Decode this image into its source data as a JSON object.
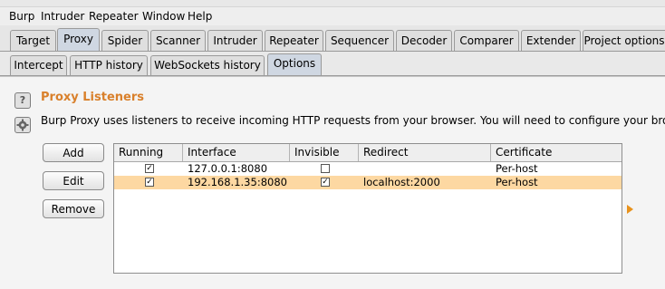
{
  "menubar": [
    "Burp",
    "Intruder",
    "Repeater",
    "Window",
    "Help"
  ],
  "main_tabs": [
    "Target",
    "Proxy",
    "Spider",
    "Scanner",
    "Intruder",
    "Repeater",
    "Sequencer",
    "Decoder",
    "Comparer",
    "Extender",
    "Project options"
  ],
  "selected_main_tab": "Proxy",
  "sub_tabs": [
    "Intercept",
    "HTTP history",
    "WebSockets history",
    "Options"
  ],
  "selected_sub_tab": "Options",
  "section": {
    "help_icon_glyph": "?",
    "title": "Proxy Listeners",
    "description": "Burp Proxy uses listeners to receive incoming HTTP requests from your browser. You will need to configure your browse"
  },
  "buttons": {
    "add": "Add",
    "edit": "Edit",
    "remove": "Remove"
  },
  "table": {
    "columns": [
      "Running",
      "Interface",
      "Invisible",
      "Redirect",
      "Certificate"
    ],
    "rows": [
      {
        "running": true,
        "interface": "127.0.0.1:8080",
        "invisible": false,
        "redirect": "",
        "certificate": "Per-host",
        "selected": false
      },
      {
        "running": true,
        "interface": "192.168.1.35:8080",
        "invisible": true,
        "redirect": "localhost:2000",
        "certificate": "Per-host",
        "selected": true
      }
    ]
  },
  "colors": {
    "accent_orange": "#d9802b",
    "selected_row": "#fdd8a2",
    "selected_tab": "#cfd7e2"
  },
  "icons": {
    "help": "question-icon",
    "settings": "gear-icon",
    "expand": "triangle-right-icon"
  }
}
